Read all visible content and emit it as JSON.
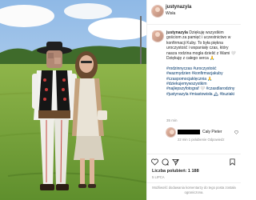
{
  "header": {
    "username": "justynazyla",
    "location": "Wisła"
  },
  "caption": {
    "username": "justynazyla",
    "text": "Dziękuję wszystkim gościom za pamięć i uczestnictwo w konfirmacji Kuby. To była piękna uroczystość i wspaniały czas, który nasza rodzina mogła dzielić z Wami 🤍 Dziękuję z całego serca 🙏",
    "hashtags": "#rodzinnyczas #uroczystość #wazmydzien #konfirmacjakuby #czaspomocjaklęcznia 🙏 #dziekujemywszystkim #najlepszyfotograf 🤍 #czasdlarodziny #justynazyla #miastowisła 🏔",
    "hashtags_end": "#buziaki",
    "time": "35 min"
  },
  "comment": {
    "text": "Cały Pieter",
    "meta": "22 min   1 polubienie   Odpowiedz"
  },
  "footer": {
    "likes": "Liczba polubień: 1 188",
    "date": "5 LIPCA",
    "restriction": "Możliwość dodawania komentarzy do tego posta została ograniczona."
  },
  "icons": [
    "heart-icon",
    "comment-icon",
    "share-icon",
    "bookmark-icon"
  ],
  "colors": {
    "link": "#00376b",
    "secondary_text": "#8e8e8e",
    "divider": "#efefef"
  }
}
